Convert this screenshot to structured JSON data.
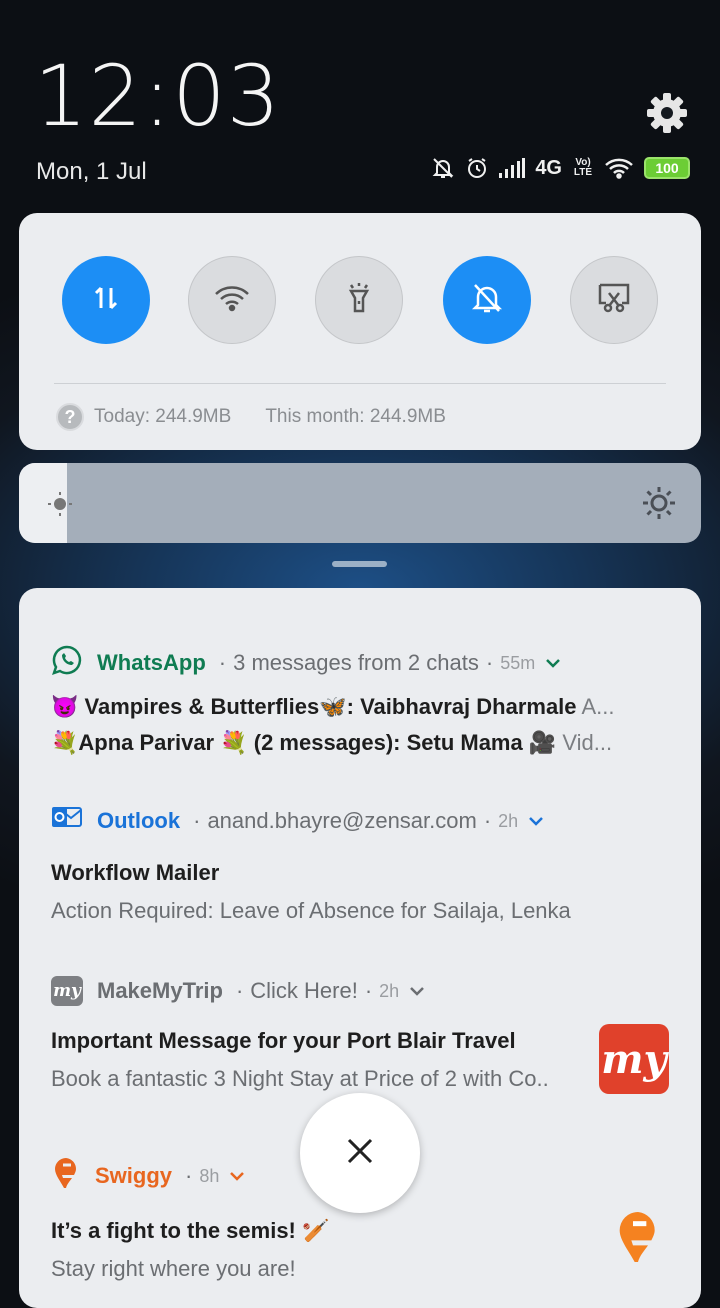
{
  "status": {
    "time": "12:03",
    "date": "Mon, 1 Jul",
    "network": "4G",
    "volte": "Vo) LTE",
    "battery": "100"
  },
  "quick_settings": {
    "toggles": [
      {
        "name": "mobile-data",
        "icon": "data-transfer-icon",
        "state": "on"
      },
      {
        "name": "wifi",
        "icon": "wifi-icon",
        "state": "off"
      },
      {
        "name": "flashlight",
        "icon": "flashlight-icon",
        "state": "off"
      },
      {
        "name": "silent",
        "icon": "bell-off-icon",
        "state": "on"
      },
      {
        "name": "screenshot",
        "icon": "screenshot-icon",
        "state": "off"
      }
    ],
    "data_today": "Today: 244.9MB",
    "data_month": "This month: 244.9MB",
    "brightness_level": 0.07
  },
  "notifications": {
    "whatsapp": {
      "app": "WhatsApp",
      "summary": "3 messages from 2 chats",
      "time": "55m",
      "accent": "#0f7c52",
      "line1_title": "😈 Vampires & Butterflies🦋: Vaibhavraj Dharmale",
      "line1_preview": "A...",
      "line2_title": "💐Apna Parivar 💐 (2 messages): Setu Mama",
      "line2_preview": "🎥 Vid..."
    },
    "outlook": {
      "app": "Outlook",
      "account": "anand.bhayre@zensar.com",
      "time": "2h",
      "accent": "#1a73d8",
      "title": "Workflow Mailer",
      "body": "Action Required: Leave of Absence for Sailaja, Lenka"
    },
    "makemytrip": {
      "app": "MakeMyTrip",
      "summary": "Click Here!",
      "time": "2h",
      "accent": "#6b6e72",
      "title": "Important Message for your Port Blair Travel",
      "body": "Book a fantastic 3 Night Stay at Price of 2 with Co..",
      "logo_text": "my"
    },
    "swiggy": {
      "app": "Swiggy",
      "time": "8h",
      "accent": "#e8661f",
      "title": "It’s a fight to the semis! 🏏",
      "body": "Stay right where you are!"
    }
  }
}
